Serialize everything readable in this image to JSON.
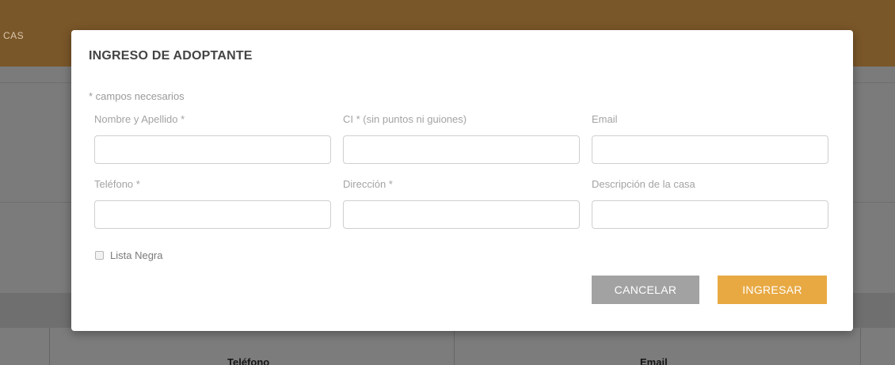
{
  "background": {
    "nav_fragment": "CAS",
    "table_headers": [
      "Teléfono",
      "Email"
    ]
  },
  "modal": {
    "title": "INGRESO DE ADOPTANTE",
    "required_note": "* campos necesarios",
    "fields": [
      {
        "label": "Nombre y Apellido *",
        "value": "",
        "placeholder": ""
      },
      {
        "label": "CI * (sin puntos ni guiones)",
        "value": "",
        "placeholder": ""
      },
      {
        "label": "Email",
        "value": "",
        "placeholder": ""
      },
      {
        "label": "Teléfono *",
        "value": "",
        "placeholder": ""
      },
      {
        "label": "Dirección *",
        "value": "",
        "placeholder": ""
      },
      {
        "label": "Descripción de la casa",
        "value": "",
        "placeholder": ""
      }
    ],
    "blacklist": {
      "label": "Lista Negra",
      "checked": false
    },
    "buttons": {
      "cancel": "CANCELAR",
      "submit": "INGRESAR"
    }
  },
  "colors": {
    "topbar": "#7a5729",
    "submit": "#e8a943",
    "cancel": "#a2a2a2"
  }
}
